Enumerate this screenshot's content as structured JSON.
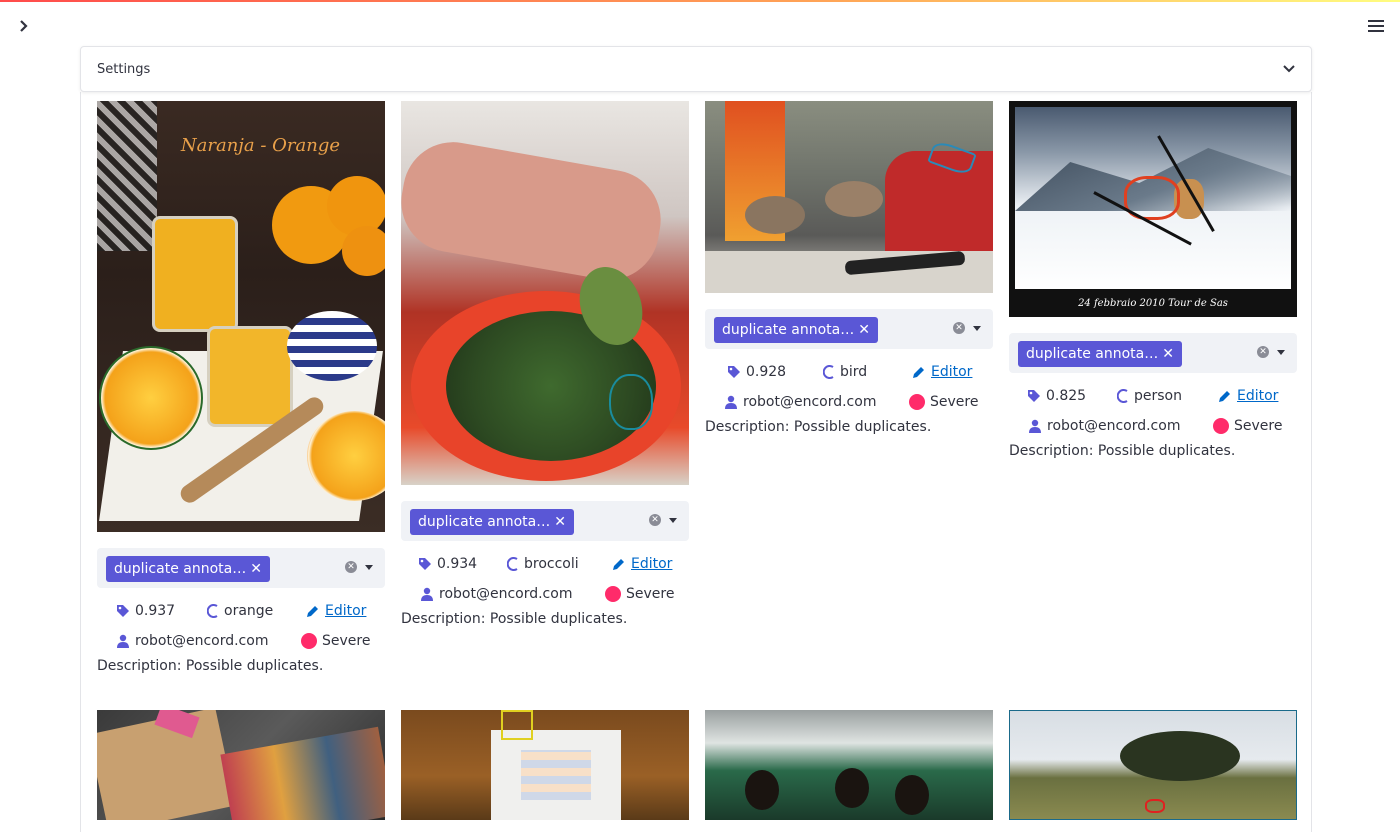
{
  "settings": {
    "label": "Settings"
  },
  "cards": [
    {
      "chip": "duplicate annota…",
      "score": "0.937",
      "label": "orange",
      "editor": "Editor",
      "user": "robot@encord.com",
      "severity": "Severe",
      "description": "Description: Possible duplicates.",
      "photo_title": "Naranja - Orange"
    },
    {
      "chip": "duplicate annota…",
      "score": "0.934",
      "label": "broccoli",
      "editor": "Editor",
      "user": "robot@encord.com",
      "severity": "Severe",
      "description": "Description: Possible duplicates."
    },
    {
      "chip": "duplicate annota…",
      "score": "0.928",
      "label": "bird",
      "editor": "Editor",
      "user": "robot@encord.com",
      "severity": "Severe",
      "description": "Description: Possible duplicates."
    },
    {
      "chip": "duplicate annota…",
      "score": "0.825",
      "label": "person",
      "editor": "Editor",
      "user": "robot@encord.com",
      "severity": "Severe",
      "description": "Description: Possible duplicates.",
      "photo_caption": "24 febbraio 2010 Tour de Sas"
    }
  ],
  "colors": {
    "accent": "#5a57d6",
    "severe": "#ff2b6a",
    "link": "#0068c9"
  },
  "icons": [
    "chevron-right-icon",
    "hamburger-menu-icon",
    "chevron-down-icon",
    "tag-icon",
    "label-icon",
    "pencil-icon",
    "user-icon",
    "severity-dot-icon",
    "close-icon"
  ]
}
